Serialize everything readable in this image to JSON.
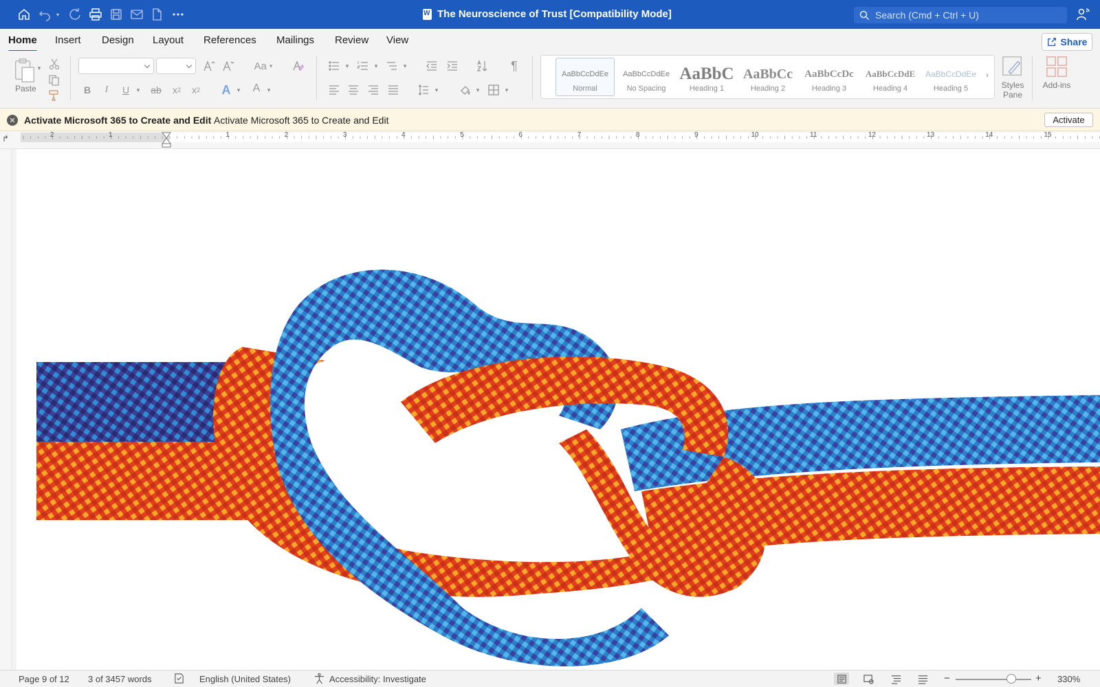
{
  "titlebar": {
    "document_title": "The Neuroscience of Trust [Compatibility Mode]",
    "search_placeholder": "Search (Cmd + Ctrl + U)",
    "icons": [
      "home-icon",
      "undo-icon",
      "redo-icon",
      "print-icon",
      "save-icon",
      "mail-icon",
      "new-document-icon",
      "more-icon",
      "share-person-icon"
    ]
  },
  "ribbon_tabs": {
    "items": [
      "Home",
      "Insert",
      "Design",
      "Layout",
      "References",
      "Mailings",
      "Review",
      "View"
    ],
    "active": "Home",
    "share_label": "Share"
  },
  "ribbon": {
    "paste_label": "Paste",
    "change_case_label": "Aa",
    "font_color_letter": "A",
    "styles": [
      {
        "sample": "AaBbCcDdEe",
        "name": "Normal"
      },
      {
        "sample": "AaBbCcDdEe",
        "name": "No Spacing"
      },
      {
        "sample": "AaBbC",
        "name": "Heading 1"
      },
      {
        "sample": "AaBbCc",
        "name": "Heading 2"
      },
      {
        "sample": "AaBbCcDc",
        "name": "Heading 3"
      },
      {
        "sample": "AaBbCcDdE",
        "name": "Heading 4"
      },
      {
        "sample": "AaBbCcDdEe",
        "name": "Heading 5"
      }
    ],
    "selected_style": "Normal",
    "styles_pane_line1": "Styles",
    "styles_pane_line2": "Pane",
    "addins_label": "Add-ins"
  },
  "notification": {
    "title": "Activate Microsoft 365 to Create and Edit",
    "message": "Activate Microsoft 365 to Create and Edit",
    "button_label": "Activate"
  },
  "ruler": {
    "labels": [
      "2",
      "1",
      "1",
      "2",
      "3",
      "4",
      "5",
      "6",
      "7",
      "8",
      "9",
      "10",
      "11",
      "12",
      "13",
      "14",
      "15"
    ]
  },
  "document": {
    "image_subject": "knot-of-blue-and-orange-ropes"
  },
  "statusbar": {
    "page": "Page 9 of 12",
    "words": "3 of 3457 words",
    "language": "English (United States)",
    "accessibility": "Accessibility: Investigate",
    "zoom_out": "−",
    "zoom_in": "+",
    "zoom_level": "330%",
    "zoom_fraction": 0.74
  },
  "colors": {
    "titlebar": "#1d5bbf",
    "rope_blue": "#2c8fd6",
    "rope_purple": "#3b3f9e",
    "rope_orange": "#e8431c",
    "rope_yellow": "#f6a623"
  }
}
